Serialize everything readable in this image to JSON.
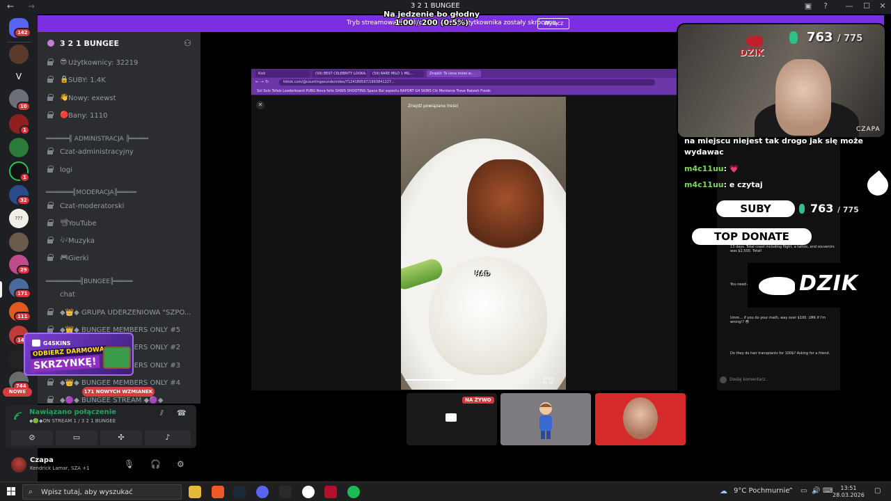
{
  "window": {
    "title": "3 2 1 BUNGEE"
  },
  "stream_banner": {
    "message": "Tryb streamowania włączony. Nazwy użytkownika zostały skrócone.",
    "button": "Wyłącz"
  },
  "overlay": {
    "line1": "Na jedzenie bo głodny",
    "line2": "1.00 / 200 (0.5%)"
  },
  "server_rail": {
    "badges": [
      "142",
      "10",
      "1",
      "1",
      "32",
      "29",
      "171",
      "111",
      "148",
      "744"
    ],
    "initial": "V",
    "question_label": "???",
    "new_label": "NOWE"
  },
  "guild": {
    "name": "3 2 1 BUNGEE",
    "channels": [
      {
        "emoji": "😎",
        "label": "Użytkownicy: 32219"
      },
      {
        "emoji": "🔒",
        "label": "SUBY: 1.4K"
      },
      {
        "emoji": "👋",
        "label": "Nowy: exewst"
      },
      {
        "emoji": "🔴",
        "label": "Bany: 1110"
      }
    ],
    "cat_admin": "══════╣ ADMINISTRACJA ╠═════",
    "admin_channels": [
      "Czat-administracyjny",
      "logi"
    ],
    "cat_mod": "═══════╣MODERACJA╠═════",
    "mod_channels": [
      {
        "emoji": "",
        "label": "Czat-moderatorski"
      },
      {
        "emoji": "📽",
        "label": "YouTube"
      },
      {
        "emoji": "🎶",
        "label": "Muzyka"
      },
      {
        "emoji": "🎮",
        "label": "Gierki"
      }
    ],
    "cat_bungee": "═════════╣BUNGEE╠═════",
    "bungee_channels": [
      "chat",
      "◆👑◆ GRUPA UDERZENIOWA \"SZPO...",
      "◆👑◆ BUNGEE MEMBERS ONLY #5",
      "◆👑◆ BUNGEE MEMBERS ONLY #2",
      "◆👑◆ BUNGEE MEMBERS ONLY #3",
      "◆👑◆ BUNGEE MEMBERS ONLY #4",
      "◆🟣◆ BUNGEE STREAM ◆🟣◆"
    ],
    "new_messages": "171 NOWYCH WZMIANEK"
  },
  "promo": {
    "brand": "G4SKINS",
    "line1": "ODBIERZ DARMOWĄ",
    "line2": "SKRZYNKĘ!"
  },
  "voice": {
    "status": "Nawiązano połączenie",
    "detail": "◆🟢◆ON STREAM 1 / 3 2 1 BUNGEE"
  },
  "user": {
    "name": "Czapa",
    "status": "Kendrick Lamar, SZA +1"
  },
  "browser": {
    "tabs": [
      "Kick",
      "(59) BEST CELEBRITY LOOKA...",
      "(59) RARE MILO 1 MIL...",
      "Znajdź: Ta cena mówi w..."
    ],
    "url": "tiktok.com/@countingsounds/video/7124180597/1993841227...",
    "bookmarks": "Sol Solo  Tofals  Leaderboard PUBG  Neva fello  DANIS SHOOTING  Space Bal aspectu  RAPORT G4 SKINS  Cik Montenie Trave  Rakesh Foods",
    "search": "Znajdź powiązane treści",
    "caption": "HAD",
    "time": "00:23 / 01:40"
  },
  "webcam": {
    "logo": "DZIK",
    "count": "763",
    "goal": "775",
    "name": "CZAPA"
  },
  "chat": {
    "lines": [
      {
        "user": "",
        "text": "na miejscu niejest tak drogo jak się może"
      },
      {
        "user": "",
        "text": "wydawac"
      },
      {
        "user": "m4c11uu",
        "text": ": 💗"
      },
      {
        "user": "m4c11uu",
        "text": ": e czytaj"
      }
    ],
    "comments": [
      "13 days. Total coast including flight, a tattoo, and souvenirs was $2,500. Total!",
      "You need over $100k? How you doing, it's not that...",
      "Umm... if you do your math, way over $100. LMK if I'm wrong!? 😳",
      "Do they do hair transplants for 100$? Asking for a friend."
    ],
    "input_placeholder": "Dodaj komentarz..."
  },
  "widgets": {
    "suby": "SUBY",
    "suby_count": "763",
    "suby_goal": "775",
    "top_donate": "TOP DONATE",
    "brand": "DZIK"
  },
  "tiles": {
    "live_label": "NA ŻYWO"
  },
  "taskbar": {
    "search_placeholder": "Wpisz tutaj, aby wyszukać",
    "weather": "9°C  Pochmurnie",
    "time": "13:51",
    "date": "28.03.2026"
  },
  "colors": {
    "banner": "#7c2fe0",
    "sidebar": "#2b2d31",
    "rail": "#1e1f22",
    "accent_green": "#23a55a",
    "danger": "#da373c"
  }
}
